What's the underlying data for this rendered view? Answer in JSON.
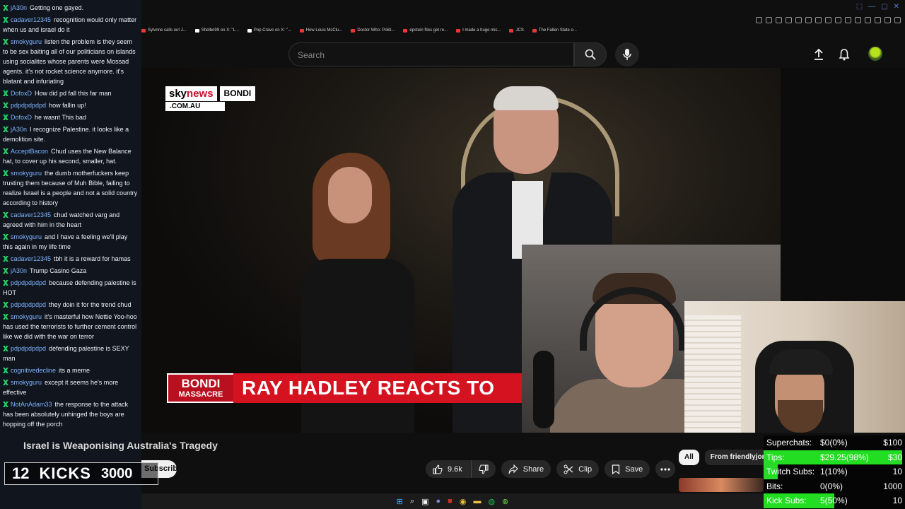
{
  "browser": {
    "window_controls": [
      "⬚",
      "—",
      "▢",
      "✕"
    ],
    "bookmarks": [
      "Sylvnne calls out J...",
      "Shelbo99 on X: \"L...",
      "Pop Crave on X: \"...",
      "How Louis McClu...",
      "Doctor Who: Politi...",
      "epstein files get re...",
      "I made a huge mis...",
      "JCS",
      "The Fallen State o..."
    ]
  },
  "header": {
    "search_placeholder": "Search"
  },
  "video": {
    "logo_brand_a": "sky",
    "logo_brand_b": "news",
    "logo_place": "BONDI",
    "logo_domain": ".COM.AU",
    "lower_third_label_1": "BONDI",
    "lower_third_label_2": "MASSACRE",
    "lower_third_headline": "RAY HADLEY REACTS TO"
  },
  "below_video": {
    "title": "Israel is Weaponising Australia's Tragedy",
    "subscribe_label": "Subscribe",
    "like_count": "9.6k",
    "share_label": "Share",
    "clip_label": "Clip",
    "save_label": "Save",
    "chips": [
      "All",
      "From friendlyjordies"
    ]
  },
  "chat": {
    "messages": [
      {
        "user": "jA30n",
        "text": "Getting one gayed."
      },
      {
        "user": "cadaver12345",
        "text": "recognition would only matter when us and israel do it"
      },
      {
        "user": "smokyguru",
        "text": "listen the problem is they seem to be sex baiting all of our politicians on islands using socialites whose parents were Mossad agents. it's not rocket science anymore. it's blatant and infuriating"
      },
      {
        "user": "DofoxD",
        "text": "How did pd fall this far man"
      },
      {
        "user": "pdpdpdpdpd",
        "text": "how fallin up!"
      },
      {
        "user": "DofoxD",
        "text": "he wasnt This bad"
      },
      {
        "user": "jA30n",
        "text": "I recognize Palestine. it looks like a demolition site."
      },
      {
        "user": "AcceptBacon",
        "text": "Chud uses the New Balance hat, to cover up his second, smaller, hat."
      },
      {
        "user": "smokyguru",
        "text": "the dumb motherfuckers keep trusting them because of Muh Bible, failing to realize Israel is a people and not a solid country according to history"
      },
      {
        "user": "cadaver12345",
        "text": "chud watched varg and agreed with him in the heart"
      },
      {
        "user": "smokyguru",
        "text": "and I have a feeling we'll play this again in my life time"
      },
      {
        "user": "cadaver12345",
        "text": "tbh it is a reward for hamas"
      },
      {
        "user": "jA30n",
        "text": "Trump Casino Gaza"
      },
      {
        "user": "pdpdpdpdpd",
        "text": "because defending palestine is HOT"
      },
      {
        "user": "pdpdpdpdpd",
        "text": "they doin it for the trend chud"
      },
      {
        "user": "smokyguru",
        "text": "it's masterful how Nettie Yoo-hoo has used the terrorists to further cement control like we did with the war on terror"
      },
      {
        "user": "pdpdpdpdpd",
        "text": "defending palestine is SEXY man"
      },
      {
        "user": "cognitivedecline",
        "text": "its a meme"
      },
      {
        "user": "smokyguru",
        "text": "except it seems he's more effective"
      },
      {
        "user": "NotAnAdam33",
        "text": "the response to the attack has been absolutely unhinged the boys are hopping off the porch"
      }
    ],
    "kicks_count": "12",
    "kicks_label": "KICKS",
    "kicks_goal": "3000"
  },
  "donations": {
    "rows": [
      {
        "label": "Superchats:",
        "current": "$0(0%)",
        "goal": "$100",
        "fill_fraction": 0.0
      },
      {
        "label": "Tips:",
        "current": "$29.25(98%)",
        "goal": "$30",
        "fill_fraction": 0.98
      },
      {
        "label": "Twitch Subs:",
        "current": "1(10%)",
        "goal": "10",
        "fill_fraction": 0.1
      },
      {
        "label": "Bits:",
        "current": "0(0%)",
        "goal": "1000",
        "fill_fraction": 0.0
      },
      {
        "label": "Kick Subs:",
        "current": "5(50%)",
        "goal": "10",
        "fill_fraction": 0.5
      }
    ]
  },
  "colors": {
    "chat_username": "#7fb3ff",
    "kick_badge": "#25d366",
    "progress_fill": "#22dd22",
    "sky_red": "#c8102e",
    "headline_red": "#d5121f"
  }
}
